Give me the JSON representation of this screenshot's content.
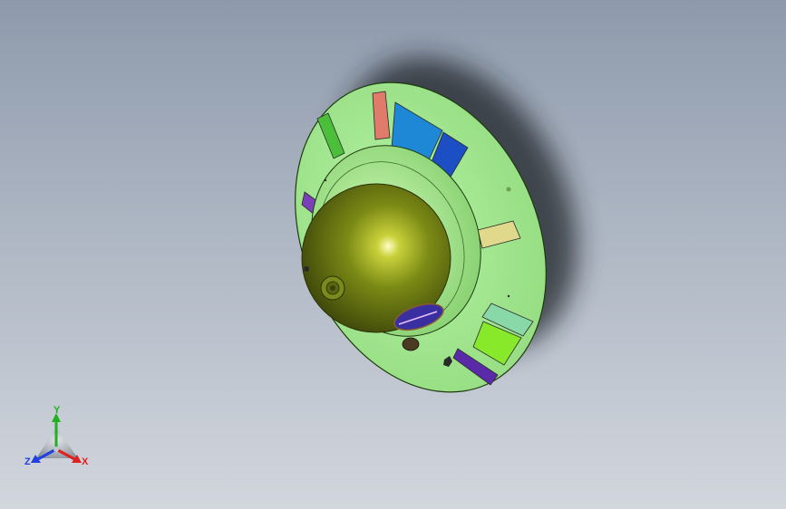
{
  "viewport": {
    "background_top": "#8e9aac",
    "background_bottom": "#d2d6dd"
  },
  "model": {
    "name": "saucer",
    "dome_color": "#6f7d12",
    "disc_color": "#9ee58c",
    "decal_colors": [
      "#e07a6a",
      "#1e88d6",
      "#1c4fc4",
      "#4cbf3a",
      "#7b3fb8",
      "#e0d88a",
      "#88d8a8",
      "#88e82a",
      "#5a2aa8"
    ]
  },
  "triad": {
    "x_label": "X",
    "y_label": "Y",
    "z_label": "Z",
    "x_color": "#e02020",
    "y_color": "#20b020",
    "z_color": "#2040e0"
  }
}
